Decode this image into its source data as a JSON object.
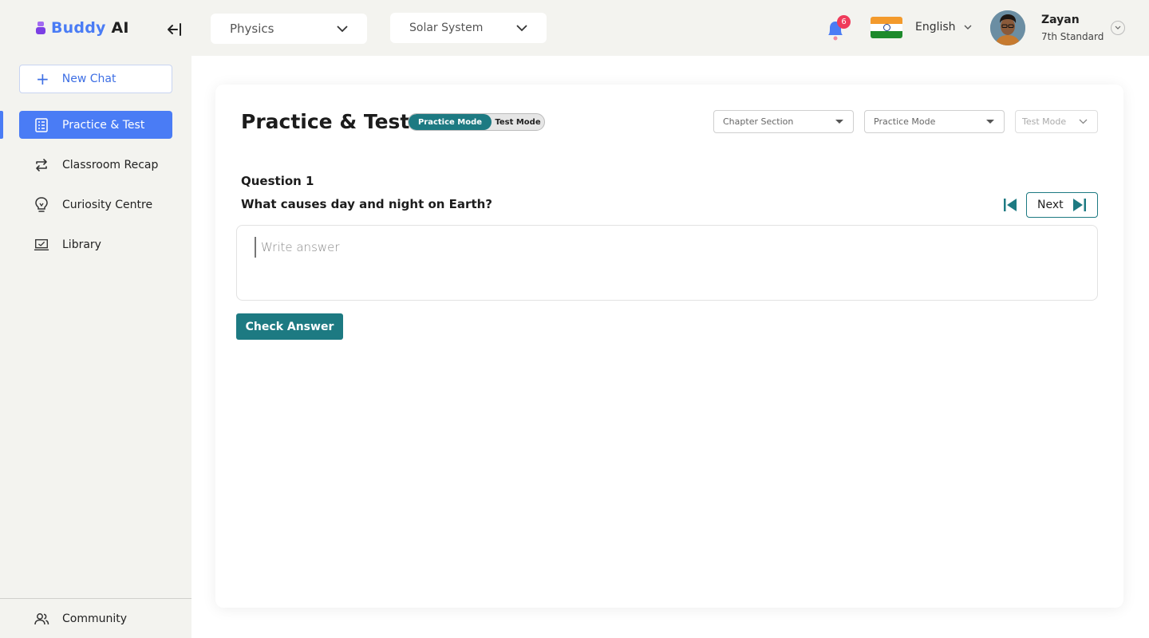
{
  "brand": {
    "name_part1": "Buddy",
    "name_part2": "AI"
  },
  "sidebar": {
    "new_chat_label": "New Chat",
    "items": [
      {
        "label": "Practice & Test",
        "icon": "clipboard-list-icon",
        "active": true
      },
      {
        "label": "Classroom Recap",
        "icon": "repeat-icon",
        "active": false
      },
      {
        "label": "Curiosity Centre",
        "icon": "lightbulb-icon",
        "active": false
      },
      {
        "label": "Library",
        "icon": "laptop-icon",
        "active": false
      }
    ],
    "community_label": "Community"
  },
  "header": {
    "subject_select": "Physics",
    "topic_select": "Solar System",
    "notification_count": "6",
    "language": "English",
    "user": {
      "name": "Zayan",
      "standard": "7th Standard"
    }
  },
  "main": {
    "title": "Practice & Test",
    "mode_toggle": {
      "practice": "Practice Mode",
      "test": "Test Mode"
    },
    "filters": {
      "chapter_section": "Chapter Section",
      "practice_mode": "Practice Mode",
      "test_mode": "Test Mode"
    },
    "question": {
      "number_label": "Question 1",
      "text": "What causes day and night on Earth?"
    },
    "next_label": "Next",
    "answer_placeholder": "Write answer",
    "check_answer_label": "Check Answer"
  },
  "colors": {
    "accent_blue": "#4a7cf5",
    "teal": "#1d7a82",
    "badge_red": "#ef3b5b",
    "brand_purple": "#7b3fe4"
  }
}
